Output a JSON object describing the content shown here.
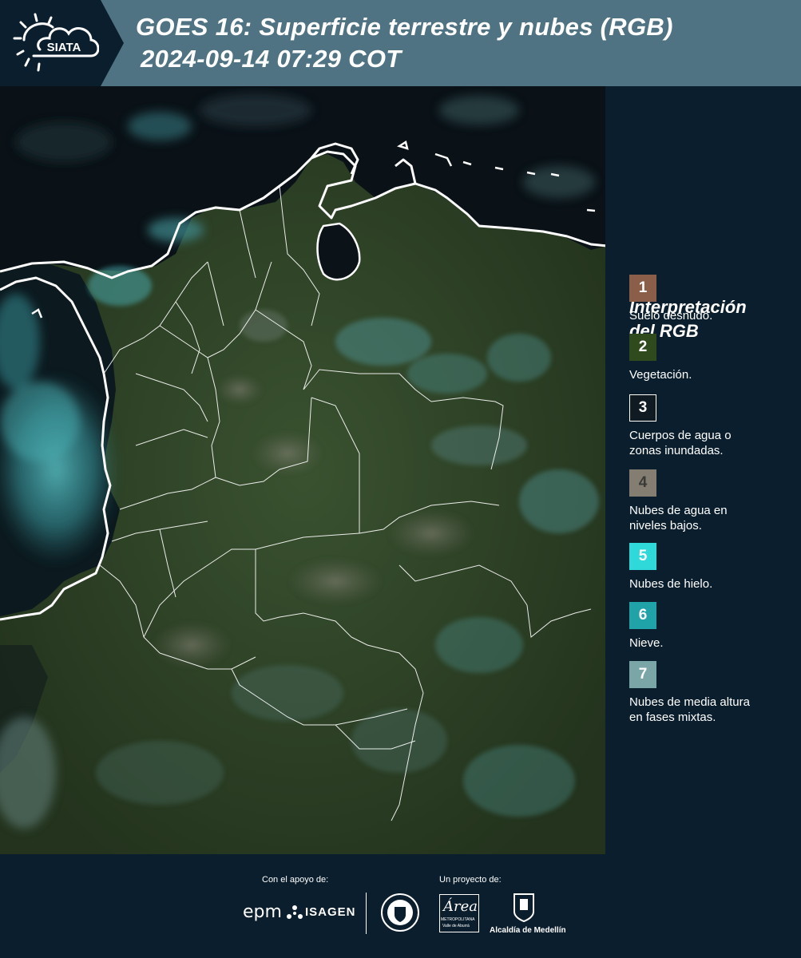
{
  "header": {
    "title_line1": "GOES 16: Superficie terrestre y nubes (RGB)",
    "title_line2": "2024-09-14 07:29 COT",
    "logo_text": "SIATA"
  },
  "legend": {
    "title_line1": "Interpretación",
    "title_line2": "del RGB",
    "items": [
      {
        "number": "1",
        "color": "#8a5e48",
        "label_lines": [
          "Suelo desnudo."
        ]
      },
      {
        "number": "2",
        "color": "#2f4a1d",
        "label_lines": [
          "Vegetación."
        ]
      },
      {
        "number": "3",
        "color": "#0f1a22",
        "label_lines": [
          "Cuerpos de agua o",
          "zonas inundadas."
        ]
      },
      {
        "number": "4",
        "color": "#847d71",
        "label_lines": [
          "Nubes de agua en",
          "niveles bajos."
        ]
      },
      {
        "number": "5",
        "color": "#2fd9da",
        "label_lines": [
          "Nubes de hielo."
        ]
      },
      {
        "number": "6",
        "color": "#1fa3a8",
        "label_lines": [
          "Nieve."
        ]
      },
      {
        "number": "7",
        "color": "#7aa6a8",
        "label_lines": [
          "Nubes de media altura",
          "en fases mixtas."
        ]
      }
    ]
  },
  "footer": {
    "support_caption": "Con el apoyo de:",
    "project_caption": "Un proyecto de:",
    "sponsors": [
      "epm",
      "ISAGEN"
    ],
    "partners": [
      "Área Metropolitana Valle de Aburrá",
      "Alcaldía de Medellín"
    ],
    "area_logo_text": "Área",
    "area_sub1": "METROPOLITANA",
    "area_sub2": "Valle de Aburrá",
    "alcaldia_text": "Alcaldía de Medellín"
  },
  "map": {
    "border_color": "#ffffff",
    "vegetation_color": "#2b3e22",
    "ocean_color": "#0a1217",
    "cloud_color": "#3fa4aa"
  }
}
